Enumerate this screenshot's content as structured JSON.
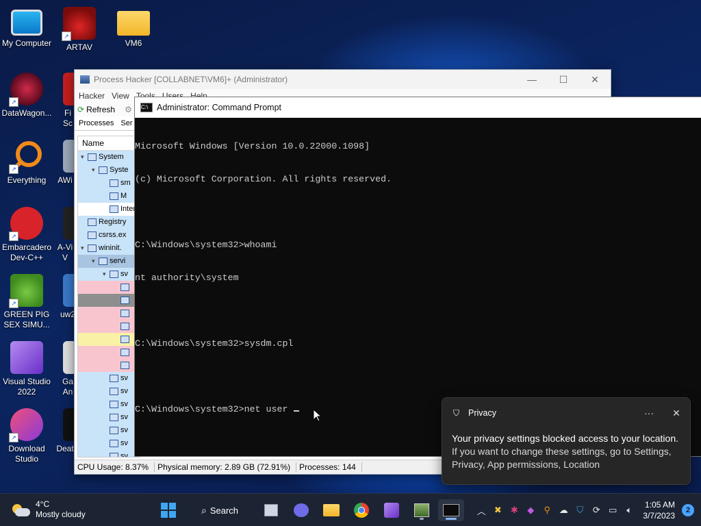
{
  "desktop": {
    "icons": [
      {
        "label": "My Computer"
      },
      {
        "label": "ARTAV"
      },
      {
        "label": "VM6"
      },
      {
        "label": "DataWagon..."
      },
      {
        "label": "Everything"
      },
      {
        "label": "Embarcadero Dev-C++"
      },
      {
        "label": "GREEN PIG SEX SIMU..."
      },
      {
        "label": "Visual Studio 2022"
      },
      {
        "label": "Download Studio"
      }
    ],
    "partial_icons": [
      {
        "label": "Fi Sc"
      },
      {
        "label": "AWi"
      },
      {
        "label": "A-Vi V"
      },
      {
        "label": "uw2"
      },
      {
        "label": "Ga An"
      },
      {
        "label": "Deat"
      }
    ]
  },
  "process_hacker": {
    "title": "Process Hacker [COLLABNET\\VM6]+ (Administrator)",
    "menu": [
      "Hacker",
      "View",
      "Tools",
      "Users",
      "Help"
    ],
    "toolbar": {
      "refresh": "Refresh"
    },
    "tabs": [
      "Processes",
      "Ser"
    ],
    "tree_header": "Name",
    "rows": [
      {
        "name": "System",
        "indent": 0,
        "twisty": "v",
        "bg": "#c9e3f8"
      },
      {
        "name": "Syste",
        "indent": 1,
        "twisty": "v",
        "bg": "#c9e3f8"
      },
      {
        "name": "sm",
        "indent": 2,
        "twisty": "",
        "bg": "#c9e3f8"
      },
      {
        "name": "M",
        "indent": 2,
        "twisty": "",
        "bg": "#c9e3f8"
      },
      {
        "name": "Inter",
        "indent": 2,
        "twisty": "",
        "bg": "#ffffff"
      },
      {
        "name": "Registry",
        "indent": 0,
        "twisty": "",
        "bg": "#c9e3f8"
      },
      {
        "name": "csrss.ex",
        "indent": 0,
        "twisty": "",
        "bg": "#c9e3f8"
      },
      {
        "name": "wininit.",
        "indent": 0,
        "twisty": "v",
        "bg": "#c9e3f8"
      },
      {
        "name": "servi",
        "indent": 1,
        "twisty": "v",
        "bg": "#a9c4e0"
      },
      {
        "name": "sv",
        "indent": 2,
        "twisty": "v",
        "bg": "#c9e3f8"
      },
      {
        "name": "",
        "indent": 3,
        "twisty": "",
        "bg": "#f8c5cf"
      },
      {
        "name": "",
        "indent": 3,
        "twisty": "",
        "bg": "#8e8e8e"
      },
      {
        "name": "",
        "indent": 3,
        "twisty": "",
        "bg": "#f8c5cf"
      },
      {
        "name": "",
        "indent": 3,
        "twisty": "",
        "bg": "#f8c5cf"
      },
      {
        "name": "",
        "indent": 3,
        "twisty": "",
        "bg": "#f9f1a5"
      },
      {
        "name": "",
        "indent": 3,
        "twisty": "",
        "bg": "#f8c5cf"
      },
      {
        "name": "",
        "indent": 3,
        "twisty": "",
        "bg": "#f8c5cf"
      },
      {
        "name": "sv",
        "indent": 2,
        "twisty": "",
        "bg": "#c9e3f8"
      },
      {
        "name": "sv",
        "indent": 2,
        "twisty": "",
        "bg": "#c9e3f8"
      },
      {
        "name": "sv",
        "indent": 2,
        "twisty": "",
        "bg": "#c9e3f8"
      },
      {
        "name": "sv",
        "indent": 2,
        "twisty": "",
        "bg": "#c9e3f8"
      },
      {
        "name": "sv",
        "indent": 2,
        "twisty": "",
        "bg": "#c9e3f8"
      },
      {
        "name": "sv",
        "indent": 2,
        "twisty": "",
        "bg": "#c9e3f8"
      },
      {
        "name": "sv",
        "indent": 2,
        "twisty": "",
        "bg": "#c9e3f8"
      }
    ],
    "status": {
      "cpu": "CPU Usage: 8.37%",
      "memory": "Physical memory: 2.89 GB (72.91%)",
      "processes": "Processes: 144"
    }
  },
  "cmd": {
    "title": "Administrator: Command Prompt",
    "lines": [
      "Microsoft Windows [Version 10.0.22000.1098]",
      "(c) Microsoft Corporation. All rights reserved.",
      "",
      "C:\\Windows\\system32>whoami",
      "nt authority\\system",
      "",
      "C:\\Windows\\system32>sysdm.cpl",
      "",
      "C:\\Windows\\system32>net user"
    ]
  },
  "toast": {
    "app": "Privacy",
    "more": "···",
    "close": "✕",
    "message": "Your privacy settings blocked access to your location.",
    "detail": "If you want to change these settings, go to Settings, Privacy, App permissions, Location"
  },
  "taskbar": {
    "weather": {
      "temp": "4°C",
      "condition": "Mostly cloudy"
    },
    "search_label": "Search",
    "time": "1:05 AM",
    "date": "3/7/2023",
    "notifications": "2"
  }
}
